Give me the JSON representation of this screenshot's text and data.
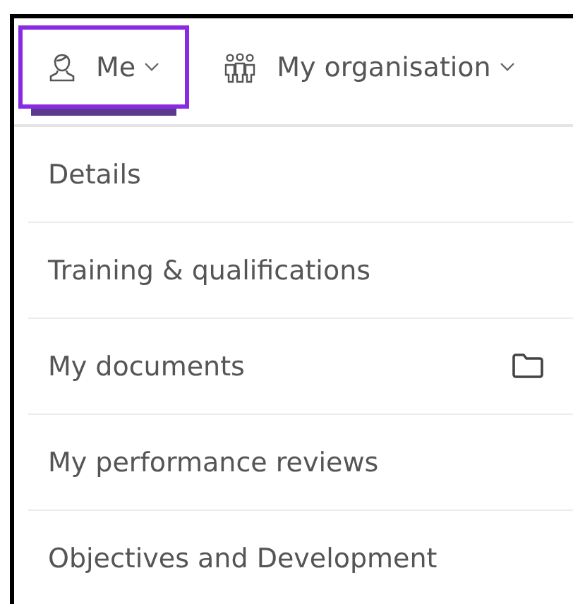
{
  "tabs": [
    {
      "label": "Me",
      "selected": true,
      "focused": true
    },
    {
      "label": "My organisation",
      "selected": false,
      "focused": false
    }
  ],
  "menu": [
    {
      "label": "Details",
      "has_folder": false
    },
    {
      "label": "Training & qualifications",
      "has_folder": false
    },
    {
      "label": "My documents",
      "has_folder": true
    },
    {
      "label": "My performance reviews",
      "has_folder": false
    },
    {
      "label": "Objectives and Development",
      "has_folder": false
    }
  ]
}
